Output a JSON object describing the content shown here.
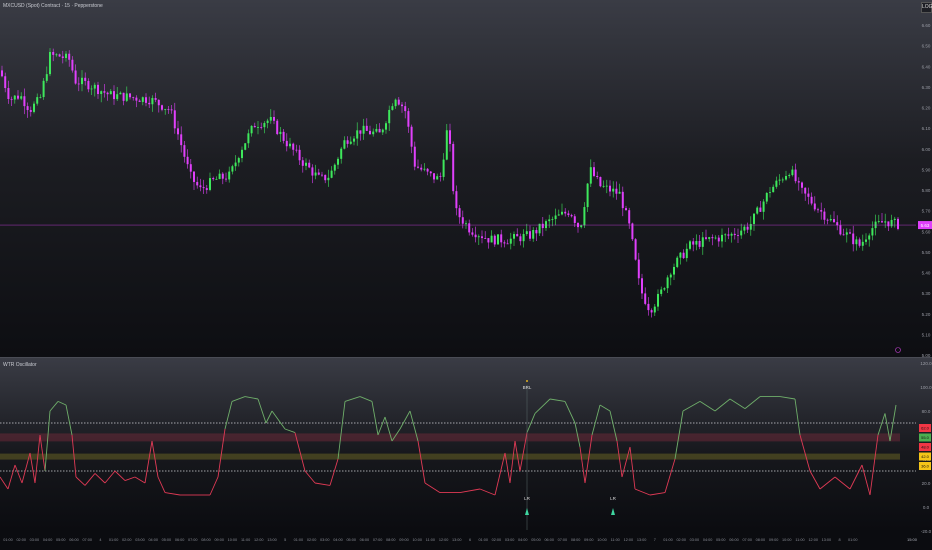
{
  "header": {
    "symbol_title": "MXCUSD (Spot) Contract · 15 · Pepperstone",
    "scale_button": "LOG"
  },
  "oscillator": {
    "title": "WTR Oscillator",
    "signals": [
      {
        "label": "BRL",
        "x_index": 527,
        "type": "top"
      },
      {
        "label": "LR",
        "x_index": 527,
        "type": "bottom"
      },
      {
        "label": "LR",
        "x_index": 613,
        "type": "bottom"
      }
    ],
    "badges": [
      {
        "text": "62.0",
        "color": "#f23645"
      },
      {
        "text": "55.0",
        "color": "#4caf50"
      },
      {
        "text": "48.0",
        "color": "#f23645"
      },
      {
        "text": "42.0",
        "color": "#f5c518"
      },
      {
        "text": "36.0",
        "color": "#f5c518"
      }
    ]
  },
  "colors": {
    "up": "#3ee85c",
    "down": "#e040fb",
    "osc_high": "#6fae6a",
    "osc_low": "#e03a55",
    "price_line": "#e040fb"
  },
  "chart_data": [
    {
      "type": "candlestick",
      "ylim": [
        5.0,
        6.6
      ],
      "yticks": [
        "6.60",
        "6.50",
        "6.40",
        "6.30",
        "6.20",
        "6.10",
        "6.00",
        "5.90",
        "5.80",
        "5.70",
        "5.60",
        "5.50",
        "5.40",
        "5.30",
        "5.20",
        "5.10",
        "5.00"
      ],
      "current_price": "5.63",
      "close": [
        [
          0,
          6.38
        ],
        [
          10,
          6.24
        ],
        [
          20,
          6.26
        ],
        [
          30,
          6.19
        ],
        [
          40,
          6.24
        ],
        [
          50,
          6.45
        ],
        [
          60,
          6.45
        ],
        [
          70,
          6.43
        ],
        [
          75,
          6.33
        ],
        [
          90,
          6.31
        ],
        [
          110,
          6.26
        ],
        [
          130,
          6.25
        ],
        [
          150,
          6.24
        ],
        [
          170,
          6.19
        ],
        [
          180,
          6.04
        ],
        [
          190,
          5.87
        ],
        [
          200,
          5.8
        ],
        [
          215,
          5.85
        ],
        [
          230,
          5.87
        ],
        [
          240,
          5.99
        ],
        [
          255,
          6.12
        ],
        [
          270,
          6.14
        ],
        [
          285,
          6.04
        ],
        [
          300,
          5.95
        ],
        [
          320,
          5.85
        ],
        [
          330,
          5.87
        ],
        [
          345,
          6.04
        ],
        [
          360,
          6.09
        ],
        [
          380,
          6.07
        ],
        [
          395,
          6.26
        ],
        [
          405,
          6.19
        ],
        [
          415,
          5.92
        ],
        [
          430,
          5.87
        ],
        [
          440,
          5.85
        ],
        [
          448,
          6.12
        ],
        [
          455,
          5.7
        ],
        [
          470,
          5.61
        ],
        [
          490,
          5.56
        ],
        [
          510,
          5.56
        ],
        [
          530,
          5.58
        ],
        [
          550,
          5.65
        ],
        [
          570,
          5.7
        ],
        [
          580,
          5.61
        ],
        [
          590,
          5.9
        ],
        [
          600,
          5.82
        ],
        [
          620,
          5.78
        ],
        [
          630,
          5.61
        ],
        [
          640,
          5.32
        ],
        [
          650,
          5.22
        ],
        [
          660,
          5.29
        ],
        [
          670,
          5.41
        ],
        [
          690,
          5.53
        ],
        [
          710,
          5.56
        ],
        [
          730,
          5.58
        ],
        [
          750,
          5.63
        ],
        [
          770,
          5.8
        ],
        [
          790,
          5.9
        ],
        [
          800,
          5.8
        ],
        [
          820,
          5.7
        ],
        [
          840,
          5.61
        ],
        [
          860,
          5.53
        ],
        [
          870,
          5.61
        ],
        [
          885,
          5.65
        ],
        [
          900,
          5.63
        ]
      ]
    },
    {
      "type": "line",
      "ylim": [
        -20,
        120
      ],
      "yticks": [
        "120.0",
        "100.0",
        "80.0",
        "60.0",
        "40.0",
        "20.0",
        "0.0",
        "-20.0"
      ],
      "levels": {
        "upper": 70,
        "lower": 30,
        "band_red": 58,
        "band_yellow": 42
      },
      "values": [
        [
          0,
          25
        ],
        [
          8,
          15
        ],
        [
          15,
          35
        ],
        [
          22,
          20
        ],
        [
          30,
          45
        ],
        [
          35,
          20
        ],
        [
          40,
          60
        ],
        [
          45,
          30
        ],
        [
          50,
          80
        ],
        [
          58,
          88
        ],
        [
          66,
          85
        ],
        [
          72,
          60
        ],
        [
          76,
          25
        ],
        [
          85,
          18
        ],
        [
          95,
          28
        ],
        [
          105,
          20
        ],
        [
          115,
          30
        ],
        [
          125,
          22
        ],
        [
          135,
          25
        ],
        [
          145,
          20
        ],
        [
          152,
          55
        ],
        [
          158,
          25
        ],
        [
          165,
          12
        ],
        [
          180,
          10
        ],
        [
          195,
          10
        ],
        [
          210,
          10
        ],
        [
          218,
          25
        ],
        [
          225,
          65
        ],
        [
          232,
          88
        ],
        [
          245,
          92
        ],
        [
          258,
          90
        ],
        [
          266,
          70
        ],
        [
          272,
          80
        ],
        [
          285,
          65
        ],
        [
          295,
          62
        ],
        [
          305,
          30
        ],
        [
          315,
          20
        ],
        [
          330,
          18
        ],
        [
          338,
          40
        ],
        [
          345,
          88
        ],
        [
          360,
          92
        ],
        [
          372,
          88
        ],
        [
          378,
          60
        ],
        [
          385,
          75
        ],
        [
          392,
          55
        ],
        [
          400,
          65
        ],
        [
          410,
          80
        ],
        [
          418,
          55
        ],
        [
          425,
          20
        ],
        [
          440,
          12
        ],
        [
          460,
          12
        ],
        [
          480,
          15
        ],
        [
          495,
          10
        ],
        [
          505,
          45
        ],
        [
          510,
          20
        ],
        [
          515,
          55
        ],
        [
          520,
          30
        ],
        [
          527,
          62
        ],
        [
          535,
          78
        ],
        [
          550,
          90
        ],
        [
          565,
          88
        ],
        [
          575,
          70
        ],
        [
          580,
          50
        ],
        [
          585,
          20
        ],
        [
          592,
          60
        ],
        [
          600,
          85
        ],
        [
          610,
          80
        ],
        [
          617,
          55
        ],
        [
          622,
          25
        ],
        [
          630,
          50
        ],
        [
          635,
          15
        ],
        [
          650,
          10
        ],
        [
          665,
          12
        ],
        [
          675,
          40
        ],
        [
          683,
          80
        ],
        [
          700,
          88
        ],
        [
          715,
          80
        ],
        [
          730,
          90
        ],
        [
          745,
          82
        ],
        [
          760,
          92
        ],
        [
          780,
          92
        ],
        [
          795,
          90
        ],
        [
          800,
          60
        ],
        [
          810,
          30
        ],
        [
          820,
          15
        ],
        [
          835,
          25
        ],
        [
          850,
          15
        ],
        [
          862,
          35
        ],
        [
          870,
          10
        ],
        [
          878,
          60
        ],
        [
          885,
          78
        ],
        [
          890,
          55
        ],
        [
          896,
          85
        ]
      ]
    }
  ],
  "time_axis": {
    "labels": [
      "01:00",
      "02:00",
      "03:00",
      "04:00",
      "05:00",
      "06:00",
      "07:00",
      "4",
      "01:00",
      "02:00",
      "03:00",
      "04:00",
      "05:00",
      "06:00",
      "07:00",
      "08:00",
      "09:00",
      "10:00",
      "11:00",
      "12:00",
      "13:00",
      "5",
      "01:00",
      "02:00",
      "03:00",
      "04:00",
      "05:00",
      "06:00",
      "07:00",
      "08:00",
      "09:00",
      "10:00",
      "11:00",
      "12:00",
      "13:00",
      "6",
      "01:00",
      "02:00",
      "03:00",
      "04:00",
      "05:00",
      "06:00",
      "07:00",
      "08:00",
      "09:00",
      "10:00",
      "11:00",
      "12:00",
      "13:00",
      "7",
      "01:00",
      "02:00",
      "03:00",
      "04:00",
      "05:00",
      "06:00",
      "07:00",
      "08:00",
      "09:00",
      "10:00",
      "11:00",
      "12:00",
      "13:00",
      "8",
      "01:00"
    ],
    "last": "15:00"
  }
}
